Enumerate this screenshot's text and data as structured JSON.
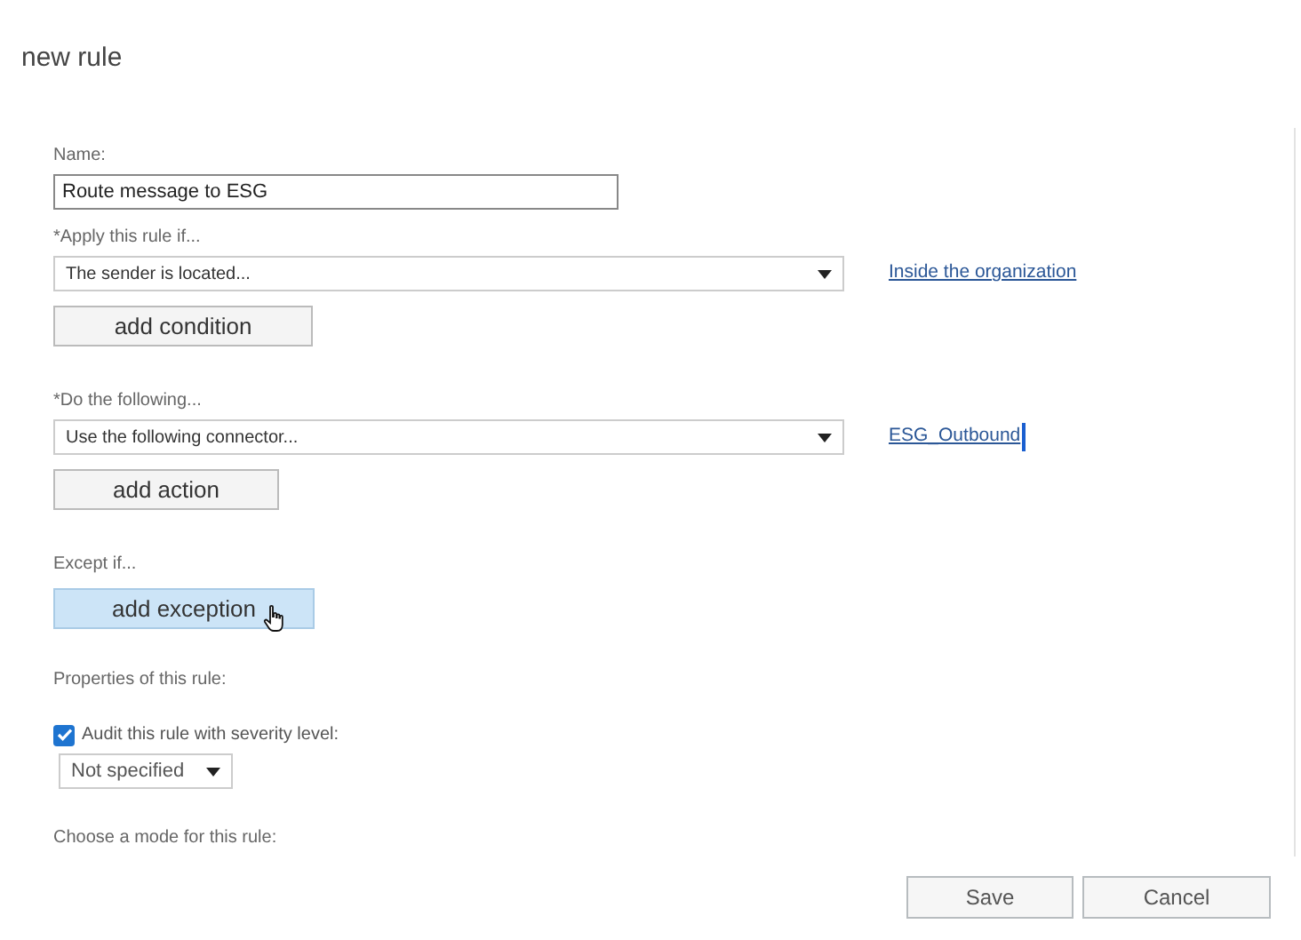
{
  "title": "new rule",
  "name_field": {
    "label": "Name:",
    "value": "Route message to ESG"
  },
  "sections": [
    {
      "label": "*Apply this rule if...",
      "select": "The sender is located...",
      "link": "Inside the organization",
      "link_focused": false,
      "button": "add condition",
      "hovered": false
    },
    {
      "label": "*Do the following...",
      "select": "Use the following connector...",
      "link": "ESG_Outbound",
      "link_focused": true,
      "button": "add action",
      "hovered": false
    }
  ],
  "exception": {
    "label": "Except if...",
    "button": "add exception",
    "hovered": true
  },
  "properties_label": "Properties of this rule:",
  "audit": {
    "label": "Audit this rule with severity level:",
    "checked": true,
    "severity": "Not specified"
  },
  "mode_label": "Choose a mode for this rule:",
  "buttons": [
    "Save",
    "Cancel"
  ]
}
